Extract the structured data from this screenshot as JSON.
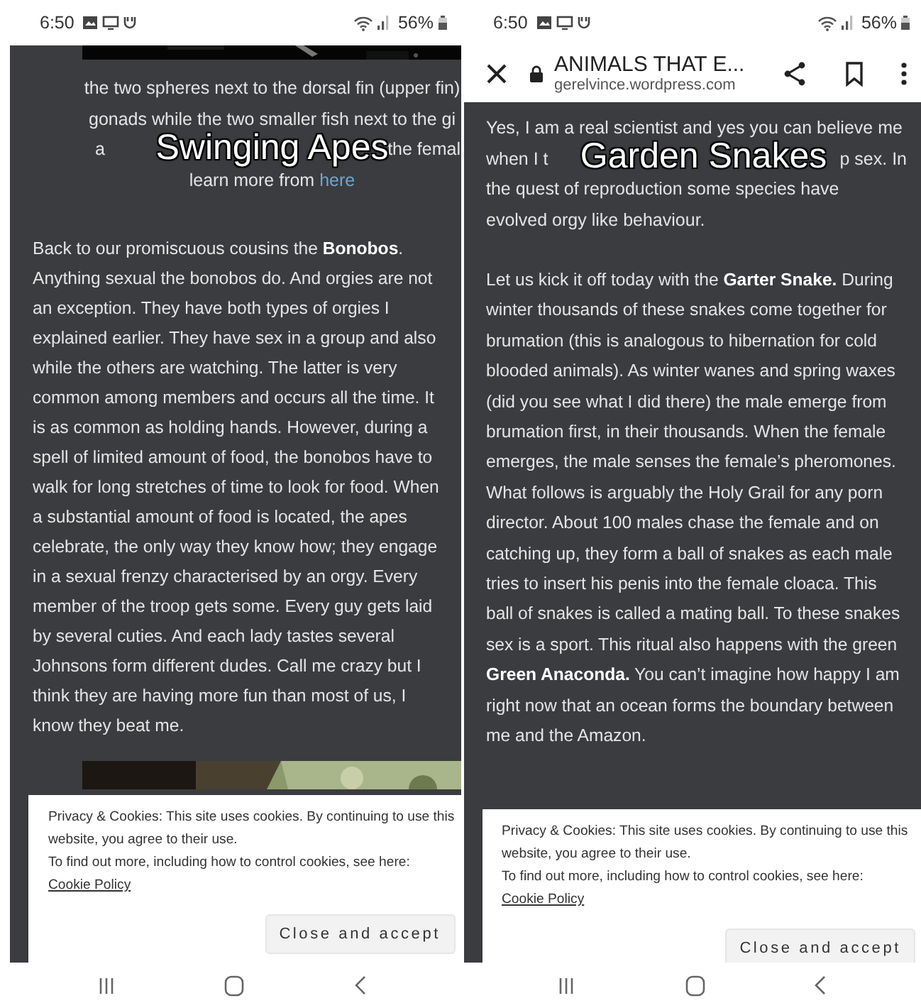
{
  "panels": [
    {
      "status_bar": {
        "time": "6:50",
        "battery": "56%"
      },
      "caption": "Swinging Apes",
      "lines_centered": true,
      "lines": [
        {
          "kind": "text",
          "text": "the two spheres next to the dorsal fin (upper fin)"
        },
        {
          "kind": "text",
          "text": "gonads while the two smaller fish next to the gi"
        },
        {
          "kind": "covered",
          "left": "a",
          "right": "the femal"
        },
        {
          "kind": "link",
          "text": "learn more from ",
          "link": "here"
        }
      ],
      "paragraphs": [
        "Back to our promiscuous cousins the **Bonobos**. Anything sexual the bonobos do. And orgies are not an exception. They have both types of orgies I explained earlier. They have sex in a group and also while the others are watching. The latter is very common among members and occurs all the time. It is as common as holding hands. However, during a spell of limited amount of food, the bonobos have to walk for long stretches of time to look for food. When a substantial amount of food is located, the apes celebrate, the only way they know how; they engage in a sexual frenzy characterised by an orgy. Every member of the troop gets some. Every guy gets laid by several cuties. And each lady tastes several Johnsons form different dudes. Call me crazy but I think they are having more fun than most of us, I know they beat me."
      ],
      "cookie_banner": {
        "text": "Privacy & Cookies: This site uses cookies. By continuing to use this website, you agree to their use.",
        "more": "To find out more, including how to control cookies, see here: ",
        "link": "Cookie Policy",
        "button": "Close and accept"
      }
    },
    {
      "status_bar": {
        "time": "6:50",
        "battery": "56%"
      },
      "toolbar": {
        "title": "ANIMALS THAT E...",
        "url": "gerelvince.wordpress.com"
      },
      "caption": "Garden Snakes",
      "lines_centered": false,
      "lines": [
        {
          "kind": "text",
          "text": "Yes, I am a real scientist and yes you can believe me"
        },
        {
          "kind": "covered",
          "left": "when I t",
          "right": "p sex. In"
        },
        {
          "kind": "text",
          "text": "the quest of reproduction some species have"
        },
        {
          "kind": "text",
          "text": "evolved orgy like behaviour."
        }
      ],
      "paragraphs": [
        "Let us kick it off today with the **Garter Snake.** During winter thousands of these snakes come together for brumation (this is analogous to hibernation for cold blooded animals). As winter wanes and spring waxes (did you see what I did there) the male emerge from brumation first, in their thousands. When the female emerges, the male senses the female’s pheromones. What follows is arguably the Holy Grail for any porn director. About 100 males chase the female and on catching up, they form a ball of snakes as each male tries to insert his penis into the female cloaca. This ball of snakes is called a mating ball. To these snakes sex is a sport. This ritual also happens with the green **Green Anaconda.** You can’t imagine how happy I am right now that an ocean forms the boundary between me and the Amazon."
      ],
      "cookie_banner": {
        "text": "Privacy & Cookies: This site uses cookies. By continuing to use this website, you agree to their use.",
        "more": "To find out more, including how to control cookies, see here: ",
        "link": "Cookie Policy",
        "button": "Close and accept"
      }
    }
  ]
}
